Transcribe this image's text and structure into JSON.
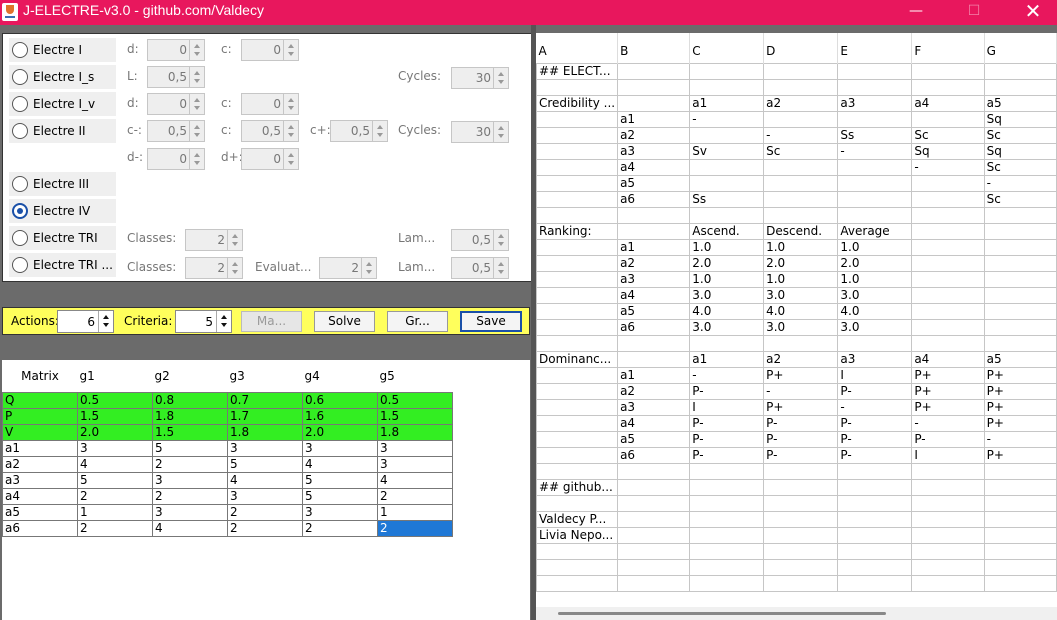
{
  "window": {
    "title": "J-ELECTRE-v3.0 - github.com/Valdecy",
    "controls": {
      "minimize": "—",
      "maximize": "☐",
      "close": "✕"
    },
    "colors": {
      "titlebar": "#e8175d",
      "toolbar": "#ffff5c",
      "matrix_highlight": "#33ee22",
      "selection": "#1f78d6"
    }
  },
  "methods": [
    {
      "label": "Electre I",
      "checked": false
    },
    {
      "label": "Electre I_s",
      "checked": false
    },
    {
      "label": "Electre I_v",
      "checked": false
    },
    {
      "label": "Electre II",
      "checked": false
    },
    {
      "label": "Electre III",
      "checked": false
    },
    {
      "label": "Electre IV",
      "checked": true
    },
    {
      "label": "Electre TRI",
      "checked": false
    },
    {
      "label": "Electre TRI ...",
      "checked": false
    }
  ],
  "params": {
    "e1_d_label": "d:",
    "e1_d": "0",
    "e1_c_label": "c:",
    "e1_c": "0",
    "eis_L_label": "L:",
    "eis_L": "0,5",
    "eis_cycles_label": "Cycles:",
    "eis_cycles": "30",
    "eiv_d_label": "d:",
    "eiv_d": "0",
    "eiv_c_label": "c:",
    "eiv_c": "0",
    "e2_cm_label": "c-:",
    "e2_cm": "0,5",
    "e2_c_label": "c:",
    "e2_c": "0,5",
    "e2_cp_label": "c+:",
    "e2_cp": "0,5",
    "e2_cycles_label": "Cycles:",
    "e2_cycles": "30",
    "e2_dm_label": "d-:",
    "e2_dm": "0",
    "e2_dp_label": "d+:",
    "e2_dp": "0",
    "tri_classes_label": "Classes:",
    "tri_classes": "2",
    "tri_lam_label": "Lam...",
    "tri_lam": "0,5",
    "tri2_classes_label": "Classes:",
    "tri2_classes": "2",
    "tri2_eval_label": "Evaluat...",
    "tri2_eval": "2",
    "tri2_lam_label": "Lam...",
    "tri2_lam": "0,5"
  },
  "toolbar": {
    "actions_label": "Actions:",
    "actions_value": "6",
    "criteria_label": "Criteria:",
    "criteria_value": "5",
    "matrix_button": "Ma...",
    "solve_button": "Solve",
    "graph_button": "Gr...",
    "save_button": "Save"
  },
  "matrix": {
    "headers": [
      "Matrix",
      "g1",
      "g2",
      "g3",
      "g4",
      "g5"
    ],
    "rows": [
      [
        "Q",
        "0.5",
        "0.8",
        "0.7",
        "0.6",
        "0.5"
      ],
      [
        "P",
        "1.5",
        "1.8",
        "1.7",
        "1.6",
        "1.5"
      ],
      [
        "V",
        "2.0",
        "1.5",
        "1.8",
        "2.0",
        "1.8"
      ],
      [
        "a1",
        "3",
        "5",
        "3",
        "3",
        "3"
      ],
      [
        "a2",
        "4",
        "2",
        "5",
        "4",
        "3"
      ],
      [
        "a3",
        "5",
        "3",
        "4",
        "5",
        "4"
      ],
      [
        "a4",
        "2",
        "2",
        "3",
        "5",
        "2"
      ],
      [
        "a5",
        "1",
        "3",
        "2",
        "3",
        "1"
      ],
      [
        "a6",
        "2",
        "4",
        "2",
        "2",
        "2"
      ]
    ]
  },
  "results": {
    "headers": [
      "A",
      "B",
      "C",
      "D",
      "E",
      "F",
      "G"
    ],
    "rows": [
      [
        "## ELECT...",
        "",
        "",
        "",
        "",
        "",
        ""
      ],
      [
        "",
        "",
        "",
        "",
        "",
        "",
        ""
      ],
      [
        "Credibility ...",
        "",
        "a1",
        "a2",
        "a3",
        "a4",
        "a5"
      ],
      [
        "",
        "a1",
        "-",
        "",
        "",
        "",
        "Sq"
      ],
      [
        "",
        "a2",
        "",
        "-",
        "Ss",
        "Sc",
        "Sc"
      ],
      [
        "",
        "a3",
        "Sv",
        "Sc",
        "-",
        "Sq",
        "Sq"
      ],
      [
        "",
        "a4",
        "",
        "",
        "",
        "-",
        "Sc"
      ],
      [
        "",
        "a5",
        "",
        "",
        "",
        "",
        "-"
      ],
      [
        "",
        "a6",
        "Ss",
        "",
        "",
        "",
        "Sc"
      ],
      [
        "",
        "",
        "",
        "",
        "",
        "",
        ""
      ],
      [
        "Ranking:",
        "",
        "Ascend.",
        "Descend.",
        "Average",
        "",
        ""
      ],
      [
        "",
        "a1",
        "1.0",
        "1.0",
        "1.0",
        "",
        ""
      ],
      [
        "",
        "a2",
        "2.0",
        "2.0",
        "2.0",
        "",
        ""
      ],
      [
        "",
        "a3",
        "1.0",
        "1.0",
        "1.0",
        "",
        ""
      ],
      [
        "",
        "a4",
        "3.0",
        "3.0",
        "3.0",
        "",
        ""
      ],
      [
        "",
        "a5",
        "4.0",
        "4.0",
        "4.0",
        "",
        ""
      ],
      [
        "",
        "a6",
        "3.0",
        "3.0",
        "3.0",
        "",
        ""
      ],
      [
        "",
        "",
        "",
        "",
        "",
        "",
        ""
      ],
      [
        "Dominanc...",
        "",
        "a1",
        "a2",
        "a3",
        "a4",
        "a5"
      ],
      [
        "",
        "a1",
        "-",
        "P+",
        "I",
        "P+",
        "P+"
      ],
      [
        "",
        "a2",
        "P-",
        "-",
        "P-",
        "P+",
        "P+"
      ],
      [
        "",
        "a3",
        "I",
        "P+",
        "-",
        "P+",
        "P+"
      ],
      [
        "",
        "a4",
        "P-",
        "P-",
        "P-",
        "-",
        "P+"
      ],
      [
        "",
        "a5",
        "P-",
        "P-",
        "P-",
        "P-",
        "-"
      ],
      [
        "",
        "a6",
        "P-",
        "P-",
        "P-",
        "I",
        "P+"
      ],
      [
        "",
        "",
        "",
        "",
        "",
        "",
        ""
      ],
      [
        "## github...",
        "",
        "",
        "",
        "",
        "",
        ""
      ],
      [
        "",
        "",
        "",
        "",
        "",
        "",
        ""
      ],
      [
        "Valdecy P...",
        "",
        "",
        "",
        "",
        "",
        ""
      ],
      [
        "Livia Nepo...",
        "",
        "",
        "",
        "",
        "",
        ""
      ],
      [
        "",
        "",
        "",
        "",
        "",
        "",
        ""
      ],
      [
        "",
        "",
        "",
        "",
        "",
        "",
        ""
      ],
      [
        "",
        "",
        "",
        "",
        "",
        "",
        ""
      ]
    ]
  }
}
